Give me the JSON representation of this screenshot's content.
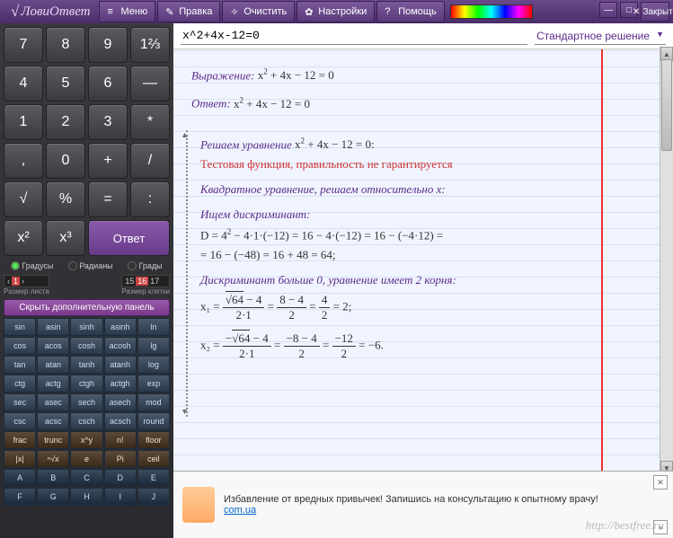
{
  "app": {
    "title": "ЛовиОтвет"
  },
  "toolbar": {
    "menu": "Меню",
    "edit": "Правка",
    "clear": "Очистить",
    "settings": "Настройки",
    "help": "Помощь",
    "close": "Закрыть"
  },
  "keypad": {
    "r1": [
      "7",
      "8",
      "9",
      "1⅔"
    ],
    "r2": [
      "4",
      "5",
      "6",
      "—"
    ],
    "r3": [
      "1",
      "2",
      "3",
      "*"
    ],
    "r4": [
      ",",
      "0",
      "+",
      "/"
    ],
    "r5": [
      "√",
      "%",
      "=",
      ":"
    ],
    "r6": [
      "x²",
      "x³",
      "Ответ"
    ]
  },
  "angles": {
    "deg": "Градусы",
    "rad": "Радианы",
    "grad": "Грады"
  },
  "sizes": {
    "sheet_label": "Размер листа",
    "sheet_vals": [
      "‹",
      "1",
      "›"
    ],
    "cell_label": "Размер клетки",
    "cell_vals": [
      "15",
      "16",
      "17"
    ]
  },
  "hide_panel": "Скрыть дополнительную панель",
  "fn": [
    [
      "sin",
      "asin",
      "sinh",
      "asinh",
      "ln"
    ],
    [
      "cos",
      "acos",
      "cosh",
      "acosh",
      "lg"
    ],
    [
      "tan",
      "atan",
      "tanh",
      "atanh",
      "log"
    ],
    [
      "ctg",
      "actg",
      "ctgh",
      "actgh",
      "exp"
    ],
    [
      "sec",
      "asec",
      "sech",
      "asech",
      "mod"
    ],
    [
      "csc",
      "acsc",
      "csch",
      "acsch",
      "round"
    ],
    [
      "frac",
      "trunc",
      "x^y",
      "n!",
      "floor"
    ],
    [
      "|x|",
      "ⁿ√x",
      "e",
      "Pi",
      "ceil"
    ],
    [
      "A",
      "B",
      "C",
      "D",
      "E"
    ],
    [
      "F",
      "G",
      "H",
      "I",
      "J"
    ]
  ],
  "input": {
    "expr": "x^2+4x-12=0",
    "mode": "Стандартное решение"
  },
  "solution": {
    "expr_label": "Выражение:",
    "answer_label": "Ответ:",
    "eq_html": "x<sup>2</sup> + 4x − 12 = 0",
    "solve_label": "Решаем уравнение",
    "solve_eq": "x<sup>2</sup> + 4x − 12 = 0:",
    "warning": "Тестовая функция, правильность не гарантируется",
    "quad_note": "Квадратное уравнение, решаем относительно x:",
    "disc_label": "Ищем дискриминант:",
    "disc_line1": "D = 4<sup>2</sup> − 4·1·(−12) = 16 − 4·(−12) = 16 − (−4·12) =",
    "disc_line2": "= 16 − (−48) = 16 + 48 = 64;",
    "roots_note": "Дискриминант больше 0, уравнение имеет 2 корня:",
    "x1_pre": "x₁ =",
    "x1_f1_n": "√64 − 4",
    "x1_f1_d": "2·1",
    "x1_f2_n": "8 − 4",
    "x1_f2_d": "2",
    "x1_f3_n": "4",
    "x1_f3_d": "2",
    "x1_res": "= 2;",
    "x2_pre": "x₂ =",
    "x2_f1_n": "−√64 − 4",
    "x2_f1_d": "2·1",
    "x2_f2_n": "−8 − 4",
    "x2_f2_d": "2",
    "x2_f3_n": "−12",
    "x2_f3_d": "2",
    "x2_res": "= −6."
  },
  "ad": {
    "text": "Избавление от вредных привычек! Запишись на консультацию к опытному врачу!",
    "link": "com.ua"
  },
  "watermark": "http://bestfree.ru"
}
